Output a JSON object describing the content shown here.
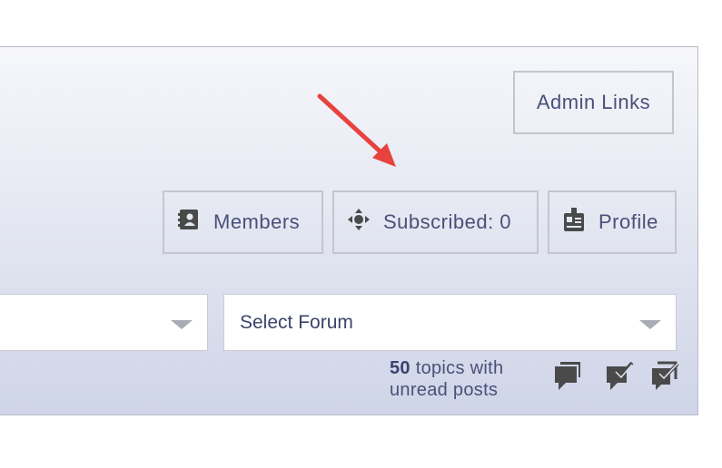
{
  "header": {
    "admin_links": "Admin Links"
  },
  "nav": {
    "members": "Members",
    "subscribed": "Subscribed: 0",
    "profile": "Profile"
  },
  "forum_select": {
    "first_value": "",
    "second_value": "Select Forum"
  },
  "unread": {
    "count": "50",
    "text_line1": " topics with",
    "text_line2": "unread posts"
  },
  "annotation": {
    "arrow_color": "#e8423f"
  },
  "icons": [
    "members-icon",
    "subscribed-icon",
    "profile-icon",
    "unread-topics-icon",
    "mark-read-icon",
    "mark-all-read-icon"
  ]
}
